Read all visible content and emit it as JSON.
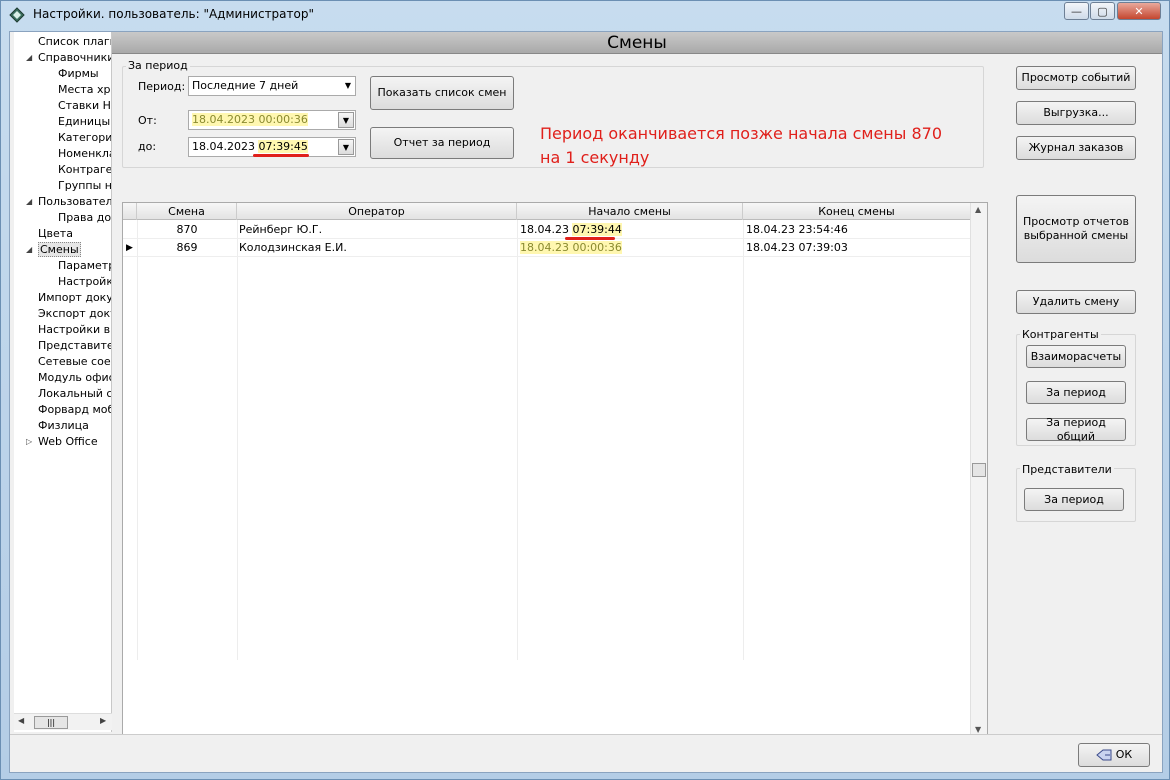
{
  "window": {
    "title": "Настройки. пользователь: \"Администратор\"",
    "controls": {
      "minimize": "—",
      "maximize": "▢",
      "close": "✕"
    }
  },
  "sidebar": {
    "items": [
      {
        "label": "Список плаги"
      },
      {
        "label": "Справочники"
      },
      {
        "label": "Фирмы"
      },
      {
        "label": "Места хра"
      },
      {
        "label": "Ставки Н,"
      },
      {
        "label": "Единицы"
      },
      {
        "label": "Категори"
      },
      {
        "label": "Номенкла"
      },
      {
        "label": "Контраге"
      },
      {
        "label": "Группы н"
      },
      {
        "label": "Пользовател"
      },
      {
        "label": "Права до"
      },
      {
        "label": "Цвета"
      },
      {
        "label": "Смены"
      },
      {
        "label": "Параметр"
      },
      {
        "label": "Настройк"
      },
      {
        "label": "Импорт доку"
      },
      {
        "label": "Экспорт доку"
      },
      {
        "label": "Настройки вн"
      },
      {
        "label": "Представите."
      },
      {
        "label": "Сетевые соед"
      },
      {
        "label": "Модуль офис"
      },
      {
        "label": "Локальный се"
      },
      {
        "label": "Форвард моб"
      },
      {
        "label": "Физлица"
      },
      {
        "label": "Web Office"
      }
    ]
  },
  "page": {
    "title": "Смены"
  },
  "period": {
    "group_label": "За период",
    "period_label": "Период:",
    "period_value": "Последние 7 дней",
    "from_label": "От:",
    "from_value": "18.04.2023 00:00:36",
    "to_label": "до:",
    "to_date": "18.04.2023 ",
    "to_time": "07:39:45",
    "show_list_button": "Показать список смен",
    "report_button": "Отчет за период"
  },
  "annotation": {
    "line1": "Период оканчивается позже начала смены 870",
    "line2": "на 1 секунду"
  },
  "table": {
    "columns": [
      "Смена",
      "Оператор",
      "Начало смены",
      "Конец смены"
    ],
    "rows": [
      {
        "shift": "870",
        "operator": "Рейнберг Ю.Г.",
        "start_date": "18.04.23 ",
        "start_time": "07:39:44",
        "end": "18.04.23 23:54:46"
      },
      {
        "shift": "869",
        "operator": "Колодзинская Е.И.",
        "start_date": "18.04.23 00:00:36",
        "start_time": "",
        "end": "18.04.23 07:39:03"
      }
    ]
  },
  "right_panel": {
    "view_events": "Просмотр событий",
    "export": "Выгрузка...",
    "orders_log": "Журнал заказов",
    "view_reports": "Просмотр отчетов выбранной смены",
    "delete_shift": "Удалить смену",
    "contractors_label": "Контрагенты",
    "mutual_settlements": "Взаиморасчеты",
    "for_period": "За период",
    "for_period_total": "За период общий",
    "representatives_label": "Представители",
    "rep_for_period": "За период"
  },
  "footer": {
    "ok": "ОК"
  }
}
